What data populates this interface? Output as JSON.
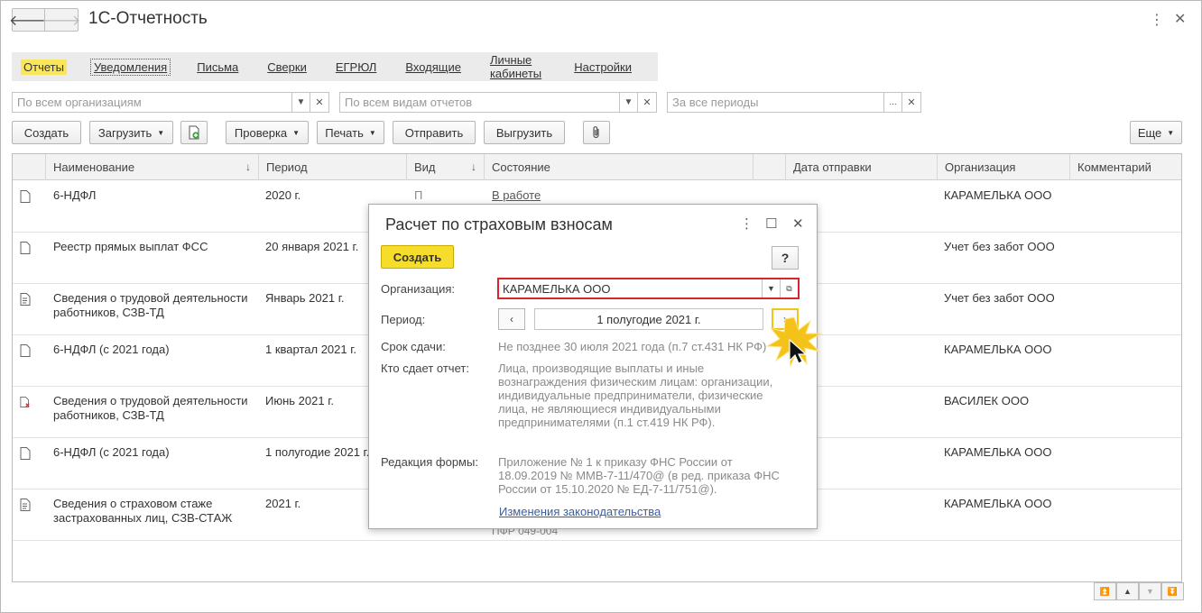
{
  "app": {
    "title": "1С-Отчетность",
    "more_glyph": "⋮",
    "close_glyph": "✕",
    "back_glyph": "🡐",
    "forward_glyph": "🡒"
  },
  "tabs": [
    {
      "label": "Отчеты"
    },
    {
      "label": "Уведомления"
    },
    {
      "label": "Письма"
    },
    {
      "label": "Сверки"
    },
    {
      "label": "ЕГРЮЛ"
    },
    {
      "label": "Входящие"
    },
    {
      "label": "Личные кабинеты"
    },
    {
      "label": "Настройки"
    }
  ],
  "filters": {
    "organizations_placeholder": "По всем организациям",
    "report_types_placeholder": "По всем видам отчетов",
    "periods_placeholder": "За все периоды"
  },
  "toolbar": {
    "create": "Создать",
    "upload": "Загрузить",
    "check": "Проверка",
    "print": "Печать",
    "send": "Отправить",
    "export": "Выгрузить",
    "more": "Еще"
  },
  "table": {
    "headers": {
      "name": "Наименование",
      "period": "Период",
      "type": "Вид",
      "state": "Состояние",
      "sent_date": "Дата отправки",
      "organization": "Организация",
      "comment": "Комментарий"
    },
    "sort_glyph": "↓",
    "rows": [
      {
        "name": "6-НДФЛ",
        "period": "2020 г.",
        "type": "П",
        "state": "В работе",
        "organization": "КАРАМЕЛЬКА ООО"
      },
      {
        "name": "Реестр прямых выплат ФСС",
        "period": "20 января 2021 г.",
        "type": "",
        "state": "",
        "organization": "Учет без забот ООО"
      },
      {
        "name": "Сведения о трудовой деятельности работников, СЗВ-ТД",
        "period": "Январь 2021 г.",
        "type": "",
        "state": "",
        "organization": "Учет без забот ООО"
      },
      {
        "name": "6-НДФЛ (с 2021 года)",
        "period": "1 квартал 2021 г.",
        "type": "",
        "state": "",
        "organization": "КАРАМЕЛЬКА ООО"
      },
      {
        "name": "Сведения о трудовой деятельности работников, СЗВ-ТД",
        "period": "Июнь 2021 г.",
        "type": "",
        "state": "",
        "organization": "ВАСИЛЕК ООО"
      },
      {
        "name": "6-НДФЛ (с 2021 года)",
        "period": "1 полугодие 2021 г.",
        "type": "",
        "state": "",
        "organization": "КАРАМЕЛЬКА ООО"
      },
      {
        "name": "Сведения о страховом стаже застрахованных лиц, СЗВ-СТАЖ",
        "period": "2021 г.",
        "type": "",
        "state": "ПФР 049-004",
        "organization": "КАРАМЕЛЬКА ООО"
      }
    ]
  },
  "dialog": {
    "title": "Расчет по страховым взносам",
    "create": "Создать",
    "help": "?",
    "org_label": "Организация:",
    "org_value": "КАРАМЕЛЬКА ООО",
    "period_label": "Период:",
    "period_value": "1 полугодие 2021 г.",
    "deadline_label": "Срок сдачи:",
    "deadline_value": "Не позднее 30 июля 2021 года (п.7 ст.431 НК РФ)",
    "who_label": "Кто сдает отчет:",
    "who_value": "Лица, производящие выплаты и иные вознаграждения физическим лицам: организации, индивидуальные предприниматели, физические лица, не являющиеся индивидуальными предпринимателями (п.1 ст.419 НК РФ).",
    "edition_label": "Редакция формы:",
    "edition_value": "Приложение № 1 к приказу ФНС России от 18.09.2019 № ММВ-7-11/470@ (в ред. приказа ФНС России от 15.10.2020 № ЕД-7-11/751@).",
    "law_link": "Изменения законодательства"
  },
  "colors": {
    "accent_yellow": "#f6dd2b",
    "highlight_red": "#d9232e",
    "link_blue": "#3b5e9e"
  }
}
